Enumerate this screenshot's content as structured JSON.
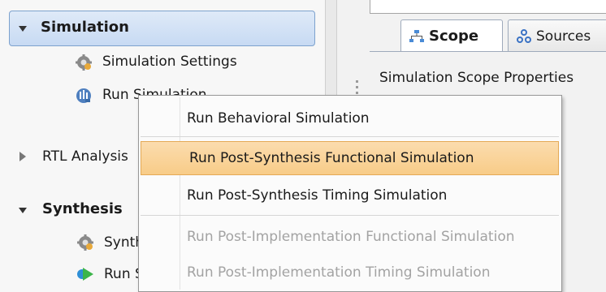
{
  "flow_navigator": {
    "simulation": {
      "label": "Simulation",
      "items": [
        {
          "label": "Simulation Settings",
          "icon": "gear-icon"
        },
        {
          "label": "Run Simulation",
          "icon": "waveform-icon"
        }
      ]
    },
    "rtl_analysis": {
      "label": "RTL Analysis"
    },
    "synthesis": {
      "label": "Synthesis",
      "items": [
        {
          "label": "Synthesis Settings",
          "icon": "gear-icon"
        },
        {
          "label": "Run Synthesis",
          "icon": "run-arrow-icon"
        }
      ]
    }
  },
  "right_panel": {
    "tabs": [
      {
        "label": "Scope",
        "icon": "hierarchy-icon",
        "active": true
      },
      {
        "label": "Sources",
        "icon": "sources-icon",
        "active": false
      }
    ],
    "properties_title": "Simulation Scope Properties"
  },
  "context_menu": {
    "items": [
      {
        "label": "Run Behavioral Simulation",
        "enabled": true,
        "highlighted": false
      },
      {
        "label": "Run Post-Synthesis Functional Simulation",
        "enabled": true,
        "highlighted": true
      },
      {
        "label": "Run Post-Synthesis Timing Simulation",
        "enabled": true,
        "highlighted": false
      },
      {
        "label": "Run Post-Implementation Functional Simulation",
        "enabled": false,
        "highlighted": false
      },
      {
        "label": "Run Post-Implementation Timing Simulation",
        "enabled": false,
        "highlighted": false
      }
    ]
  },
  "colors": {
    "selection_header": "#c7daf3",
    "menu_highlight": "#f8cc88",
    "disabled_text": "#a3a3a3"
  }
}
